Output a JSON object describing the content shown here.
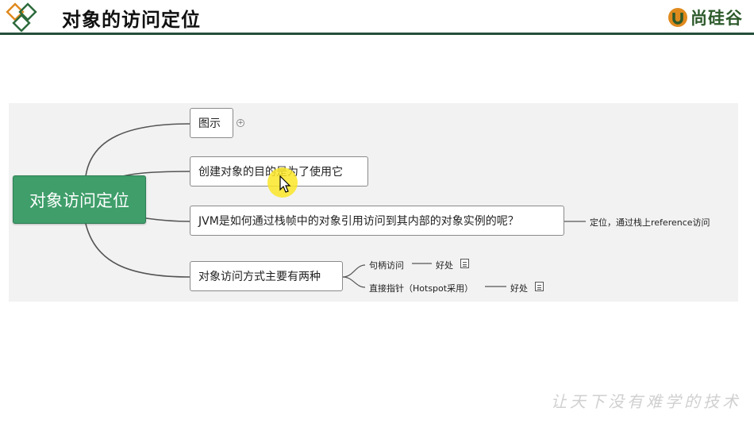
{
  "header": {
    "title": "对象的访问定位",
    "brand_text": "尚硅谷",
    "colors": {
      "rule": "#244e3a",
      "brand": "#2d5a2b",
      "logo_orange": "#e08a1e",
      "logo_green": "#2d6b3c"
    }
  },
  "mindmap": {
    "root": {
      "label": "对象访问定位",
      "color": "#3f9e6a"
    },
    "branches": [
      {
        "label": "图示",
        "icon": "expand-plus-icon"
      },
      {
        "label": "创建对象的目的是为了使用它"
      },
      {
        "label": "JVM是如何通过栈帧中的对象引用访问到其内部的对象实例的呢？",
        "child": "定位，通过栈上reference访问"
      },
      {
        "label": "对象访问方式主要有两种",
        "children": [
          {
            "label": "句柄访问",
            "detail": "好处",
            "icon": "note-icon"
          },
          {
            "label": "直接指针（Hotspot采用）",
            "detail": "好处",
            "icon": "note-icon"
          }
        ]
      }
    ]
  },
  "watermark": "让天下没有难学的技术"
}
